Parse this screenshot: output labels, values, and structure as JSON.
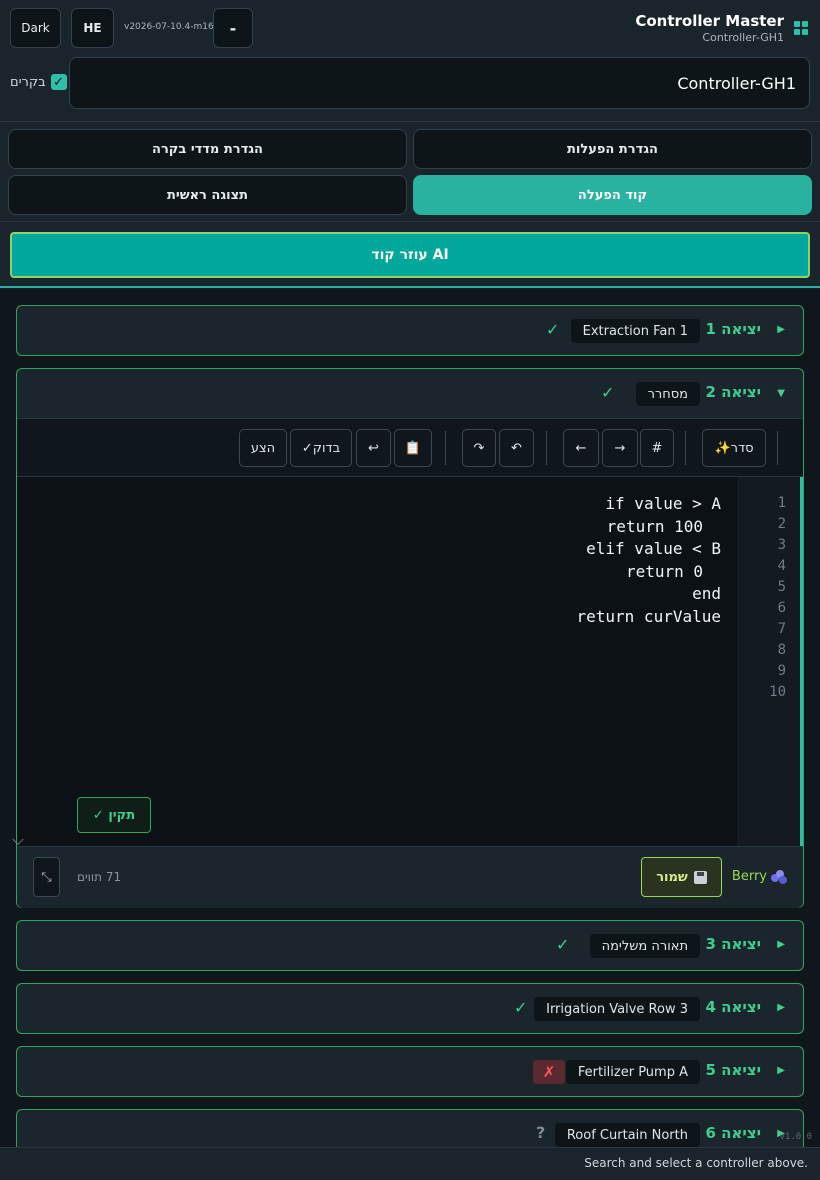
{
  "header": {
    "theme_button": "Dark",
    "lang_button": "HE",
    "version": "v2026-07-10.4-m16",
    "minus_button": "-",
    "app_title": "Controller Master",
    "app_subtitle": "Controller-GH1",
    "controller_input_value": "Controller-GH1",
    "controllers_checkbox_label": "בקרים",
    "controllers_checkbox_checked": true
  },
  "nav": {
    "tabs": [
      {
        "label": "הגדרת הפעלות",
        "active": false
      },
      {
        "label": "הגדרת מדדי בקרה",
        "active": false
      },
      {
        "label": "קוד הפעלה",
        "active": true
      },
      {
        "label": "תצוגה ראשית",
        "active": false
      }
    ],
    "ai_button": "עוזר קוד AI"
  },
  "outputs": [
    {
      "title": "יציאה 1",
      "name": "Extraction Fan 1",
      "status": "✓",
      "expanded": false
    },
    {
      "title": "יציאה 2",
      "name": "מסחרר",
      "status": "✓",
      "expanded": true
    },
    {
      "title": "יציאה 3",
      "name": "תאורה משלימה",
      "status": "✓",
      "expanded": false
    },
    {
      "title": "יציאה 4",
      "name": "Irrigation Valve Row 3",
      "status": "✓",
      "expanded": false
    },
    {
      "title": "יציאה 5",
      "name": "Fertilizer Pump A",
      "status": "✗",
      "expanded": false
    },
    {
      "title": "יציאה 6",
      "name": "Roof Curtain North",
      "status": "?",
      "expanded": false
    }
  ],
  "editor": {
    "toolbar": {
      "format": "✨סדר",
      "comment": "#",
      "indent": "→",
      "outdent": "←",
      "undo": "↶",
      "redo": "↷",
      "paste": "📋",
      "wrap": "↩",
      "check": "✓בדוק",
      "run": "הצע"
    },
    "line_numbers": [
      "1",
      "2",
      "3",
      "4",
      "5",
      "6",
      "7",
      "8",
      "9",
      "10"
    ],
    "code_lines": [
      "if value > A",
      "return 100",
      "elif value < B",
      "return 0",
      "end",
      "return curValue"
    ],
    "fix_button": "✓ תקין",
    "language": "Berry",
    "save_button": "שמור",
    "char_count": "71 תווים",
    "expand_icon": "⤡"
  },
  "footer": {
    "version_tag": "v1.0.0",
    "status_text": "Search and select a controller above."
  },
  "colors": {
    "accent": "#27b3a0",
    "ok": "#3dcf8e",
    "error": "#ff5a5a",
    "save": "#9ad94f"
  }
}
